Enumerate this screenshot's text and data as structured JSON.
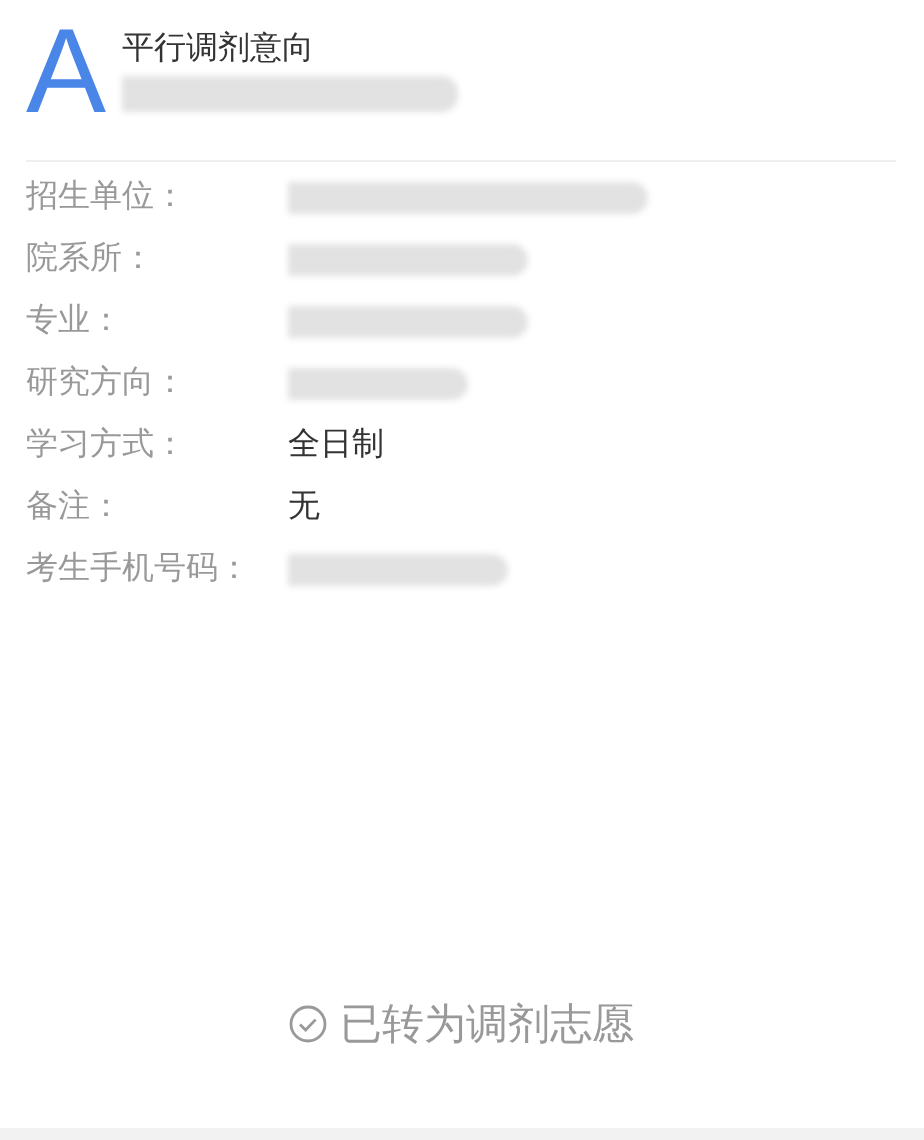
{
  "header": {
    "letter": "A",
    "title": "平行调剂意向",
    "subtitle_redacted": true
  },
  "fields": [
    {
      "label": "招生单位：",
      "redacted": true
    },
    {
      "label": "院系所：",
      "redacted": true
    },
    {
      "label": "专业：",
      "redacted": true
    },
    {
      "label": "研究方向：",
      "redacted": true
    },
    {
      "label": "学习方式：",
      "value": "全日制",
      "redacted": false
    },
    {
      "label": "备注：",
      "value": "无",
      "redacted": false
    },
    {
      "label": "考生手机号码：",
      "redacted": true
    }
  ],
  "status": {
    "text": "已转为调剂志愿",
    "done": true
  }
}
